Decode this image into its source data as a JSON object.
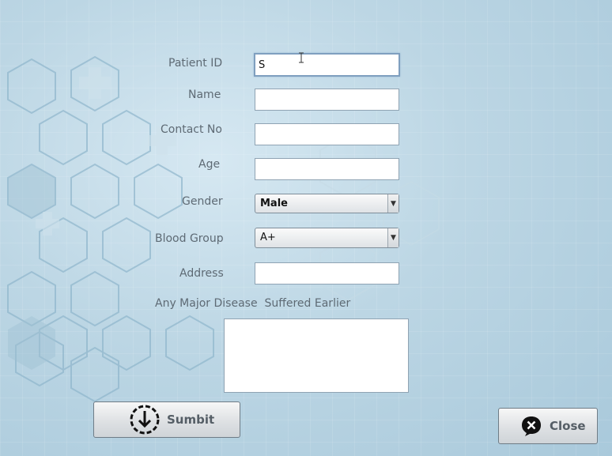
{
  "form": {
    "patient_id_label": "Patient ID",
    "patient_id_value": "S",
    "name_label": "Name",
    "name_value": "",
    "contact_label": "Contact No",
    "contact_value": "",
    "age_label": "Age",
    "age_value": "",
    "gender_label": "Gender",
    "gender_value": "Male",
    "blood_group_label": "Blood Group",
    "blood_group_value": "A+",
    "address_label": "Address",
    "address_value": "",
    "disease_label": "Any Major Disease  Suffered Earlier",
    "disease_value": ""
  },
  "buttons": {
    "submit_label": "Sumbit",
    "close_label": "Close"
  },
  "icons": {
    "submit": "download-circle-icon",
    "close": "close-speech-bubble-icon"
  },
  "colors": {
    "background": "#bcd6e4",
    "field_border": "#8fa3b3",
    "label_text": "#5e6a74"
  }
}
